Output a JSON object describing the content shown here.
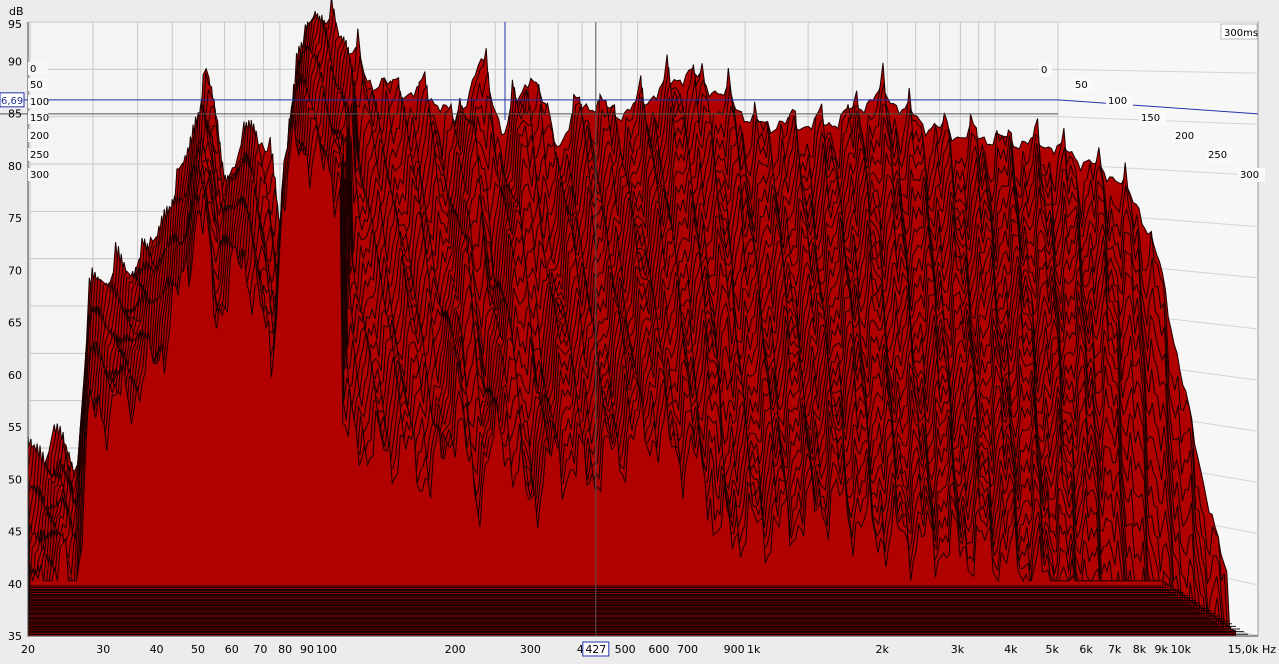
{
  "chart_data": {
    "type": "area",
    "y_unit_label": "dB",
    "x_unit_label": "Hz",
    "x_scale": "log",
    "xlim": [
      20,
      15000
    ],
    "ylim": [
      35,
      95
    ],
    "x_ticks": [
      {
        "v": 20,
        "label": "20"
      },
      {
        "v": 30,
        "label": "30"
      },
      {
        "v": 40,
        "label": "40"
      },
      {
        "v": 50,
        "label": "50"
      },
      {
        "v": 60,
        "label": "60"
      },
      {
        "v": 70,
        "label": "70"
      },
      {
        "v": 80,
        "label": "80"
      },
      {
        "v": 90,
        "label": "90"
      },
      {
        "v": 100,
        "label": "100"
      },
      {
        "v": 200,
        "label": "200"
      },
      {
        "v": 300,
        "label": "300"
      },
      {
        "v": 400,
        "label": "40"
      },
      {
        "v": 500,
        "label": "500"
      },
      {
        "v": 600,
        "label": "600"
      },
      {
        "v": 700,
        "label": "700"
      },
      {
        "v": 900,
        "label": "900"
      },
      {
        "v": 1000,
        "label": "1k"
      },
      {
        "v": 2000,
        "label": "2k"
      },
      {
        "v": 3000,
        "label": "3k"
      },
      {
        "v": 4000,
        "label": "4k"
      },
      {
        "v": 5000,
        "label": "5k"
      },
      {
        "v": 6000,
        "label": "6k"
      },
      {
        "v": 7000,
        "label": "7k"
      },
      {
        "v": 8000,
        "label": "8k"
      },
      {
        "v": 9000,
        "label": "9k"
      },
      {
        "v": 10000,
        "label": "10k"
      },
      {
        "v": 15000,
        "label": "15,0k Hz"
      }
    ],
    "y_ticks": [
      {
        "v": 95,
        "label": "95"
      },
      {
        "v": 90,
        "label": "90"
      },
      {
        "v": 85,
        "label": "85"
      },
      {
        "v": 80,
        "label": "80"
      },
      {
        "v": 75,
        "label": "75"
      },
      {
        "v": 70,
        "label": "70"
      },
      {
        "v": 65,
        "label": "65"
      },
      {
        "v": 60,
        "label": "60"
      },
      {
        "v": 55,
        "label": "55"
      },
      {
        "v": 50,
        "label": "50"
      },
      {
        "v": 45,
        "label": "45"
      },
      {
        "v": 40,
        "label": "40"
      },
      {
        "v": 35,
        "label": "35"
      }
    ],
    "time_axis_ms": [
      0,
      50,
      100,
      150,
      200,
      250,
      300
    ],
    "time_axis_labels": [
      "0",
      "50",
      "100",
      "150",
      "200",
      "250",
      "300"
    ],
    "time_axis_end_label": "300ms",
    "slice_count": 31,
    "cursor": {
      "frequency_hz": 427,
      "frequency_label": "427",
      "level_db": 86.69,
      "level_label": "6,69"
    },
    "envelope_first_slice": [
      [
        20,
        51
      ],
      [
        22,
        51.5
      ],
      [
        24,
        53.5
      ],
      [
        26,
        50
      ],
      [
        28,
        67
      ],
      [
        30,
        68.5
      ],
      [
        33,
        68.8
      ],
      [
        40,
        72
      ],
      [
        48,
        80
      ],
      [
        52,
        87.5
      ],
      [
        55,
        85
      ],
      [
        58,
        78
      ],
      [
        62,
        80
      ],
      [
        66,
        82
      ],
      [
        70,
        82.5
      ],
      [
        75,
        78
      ],
      [
        80,
        72
      ],
      [
        85,
        88
      ],
      [
        90,
        92
      ],
      [
        95,
        94
      ],
      [
        100,
        93.5
      ],
      [
        108,
        91
      ],
      [
        115,
        91
      ],
      [
        125,
        88
      ],
      [
        135,
        88
      ],
      [
        150,
        87
      ],
      [
        165,
        87
      ],
      [
        175,
        86.5
      ],
      [
        185,
        86
      ],
      [
        200,
        84
      ],
      [
        230,
        90
      ],
      [
        260,
        83
      ],
      [
        300,
        89
      ],
      [
        350,
        82
      ],
      [
        400,
        86
      ],
      [
        500,
        85
      ],
      [
        700,
        89
      ],
      [
        900,
        86
      ],
      [
        1000,
        84
      ],
      [
        1500,
        84
      ],
      [
        2000,
        87
      ],
      [
        2500,
        84
      ],
      [
        3000,
        83
      ],
      [
        5000,
        82
      ],
      [
        7000,
        79
      ],
      [
        8000,
        76
      ],
      [
        9000,
        70
      ],
      [
        10000,
        60
      ],
      [
        12000,
        45
      ],
      [
        13000,
        40
      ]
    ],
    "colors": {
      "fill": "#b00000",
      "outline": "#1a0000",
      "cursor": "#2233aa",
      "background": "#ececec",
      "grid": "#c8c8c8"
    }
  }
}
